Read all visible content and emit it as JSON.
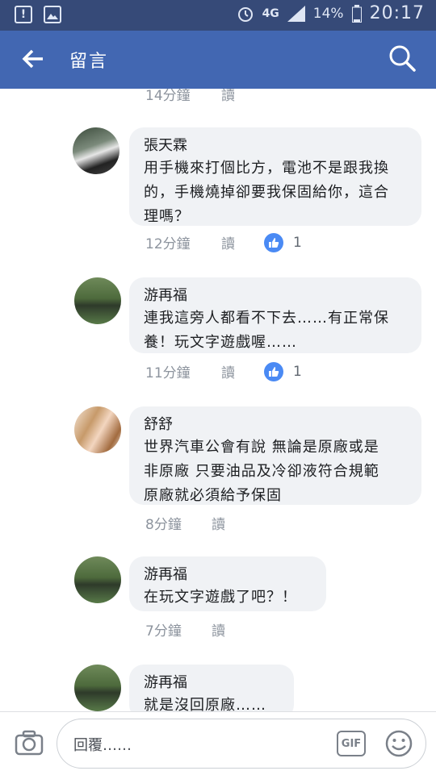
{
  "status_bar": {
    "network": "4G",
    "battery": "14%",
    "time": "20:17"
  },
  "header": {
    "title": "留言",
    "back_icon": "arrow-left-icon",
    "search_icon": "search-icon"
  },
  "top_meta": {
    "time": "14分鐘",
    "read": "讀"
  },
  "comments": [
    {
      "name": "張天霖",
      "lines": [
        "用手機來打個比方，電池不是跟我換",
        "的，手機燒掉卻要我保固給你，這合",
        "理嗎？"
      ],
      "time": "12分鐘",
      "read": "讀",
      "likes": "1"
    },
    {
      "name": "游再福",
      "lines": [
        "連我這旁人都看不下去……有正常保",
        "養！玩文字遊戲喔……"
      ],
      "time": "11分鐘",
      "read": "讀",
      "likes": "1"
    },
    {
      "name": "舒舒",
      "lines": [
        "世界汽車公會有說 無論是原廠或是",
        "非原廠 只要油品及冷卻液符合規範",
        "原廠就必須給予保固"
      ],
      "time": "8分鐘",
      "read": "讀"
    },
    {
      "name": "游再福",
      "lines": [
        "在玩文字遊戲了吧？！"
      ],
      "time": "7分鐘",
      "read": "讀"
    },
    {
      "name": "游再福",
      "lines": [
        "就是沒回原廠……"
      ]
    }
  ],
  "composer": {
    "placeholder": "回覆……",
    "gif_label": "GIF"
  },
  "colors": {
    "brand": "#4267b2",
    "status_bar": "#364a78",
    "like": "#4a8af4"
  }
}
